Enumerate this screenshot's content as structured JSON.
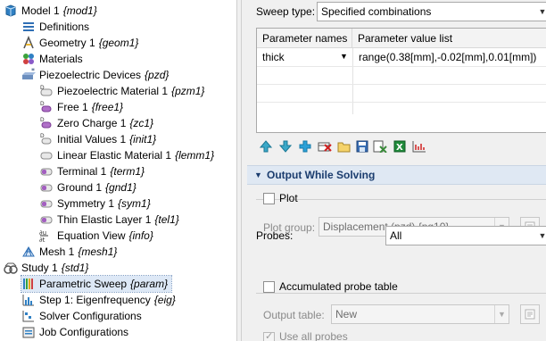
{
  "tree": {
    "nodes": [
      {
        "label": "Model 1",
        "tag": "{mod1}",
        "icon": "model-icon"
      },
      {
        "label": "Definitions",
        "tag": "",
        "icon": "definitions-icon"
      },
      {
        "label": "Geometry 1",
        "tag": "{geom1}",
        "icon": "geometry-icon"
      },
      {
        "label": "Materials",
        "tag": "",
        "icon": "materials-icon"
      },
      {
        "label": "Piezoelectric Devices",
        "tag": "{pzd}",
        "icon": "physics-icon"
      },
      {
        "label": "Piezoelectric Material 1",
        "tag": "{pzm1}",
        "icon": "domain-node-icon"
      },
      {
        "label": "Free 1",
        "tag": "{free1}",
        "icon": "default-node-icon"
      },
      {
        "label": "Zero Charge 1",
        "tag": "{zc1}",
        "icon": "default-node-icon"
      },
      {
        "label": "Initial Values 1",
        "tag": "{init1}",
        "icon": "default-node-icon"
      },
      {
        "label": "Linear Elastic Material 1",
        "tag": "{lemm1}",
        "icon": "domain-node-icon"
      },
      {
        "label": "Terminal 1",
        "tag": "{term1}",
        "icon": "boundary-node-icon"
      },
      {
        "label": "Ground 1",
        "tag": "{gnd1}",
        "icon": "boundary-node-icon"
      },
      {
        "label": "Symmetry 1",
        "tag": "{sym1}",
        "icon": "boundary-node-icon"
      },
      {
        "label": "Thin Elastic Layer 1",
        "tag": "{tel1}",
        "icon": "boundary-node-icon"
      },
      {
        "label": "Equation View",
        "tag": "{info}",
        "icon": "equation-icon"
      },
      {
        "label": "Mesh 1",
        "tag": "{mesh1}",
        "icon": "mesh-icon"
      },
      {
        "label": "Study 1",
        "tag": "{std1}",
        "icon": "study-icon"
      },
      {
        "label": "Parametric Sweep",
        "tag": "{param}",
        "icon": "parametric-sweep-icon"
      },
      {
        "label": "Step 1: Eigenfrequency",
        "tag": "{eig}",
        "icon": "study-step-icon"
      },
      {
        "label": "Solver Configurations",
        "tag": "",
        "icon": "solver-configurations-icon"
      },
      {
        "label": "Job Configurations",
        "tag": "",
        "icon": "job-configurations-icon"
      }
    ]
  },
  "settings": {
    "sweep_type_label": "Sweep type:",
    "sweep_type_value": "Specified combinations",
    "table": {
      "headers": [
        "Parameter names",
        "Parameter value list"
      ],
      "rows": [
        {
          "name": "thick",
          "values": "range(0.38[mm],-0.02[mm],0.01[mm])"
        }
      ]
    },
    "toolbar_icons": [
      "move-up-icon",
      "move-down-icon",
      "add-icon",
      "delete-icon",
      "open-icon",
      "save-icon",
      "clear-icon",
      "export-excel-icon",
      "range-icon"
    ],
    "output_section_title": "Output While Solving",
    "plot_label": "Plot",
    "plot_group_label": "Plot group:",
    "plot_group_value": "Displacement (pzd) {pg10}",
    "probes_label": "Probes:",
    "probes_value": "All",
    "accumulated_label": "Accumulated probe table",
    "output_table_label": "Output table:",
    "output_table_value": "New",
    "use_all_probes_label": "Use all probes"
  }
}
